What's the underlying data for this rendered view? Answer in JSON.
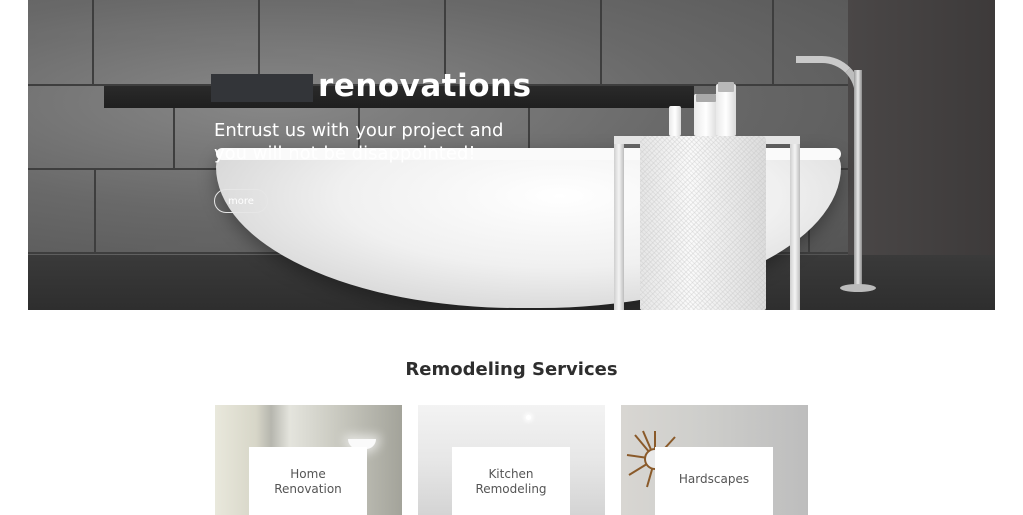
{
  "hero": {
    "title": "renovations",
    "subtitle": "Entrust us with your project and you will not be disappointed!",
    "more_button": "more"
  },
  "services": {
    "heading": "Remodeling Services",
    "cards": [
      {
        "label": "Home Renovation"
      },
      {
        "label": "Kitchen Remodeling"
      },
      {
        "label": "Hardscapes"
      }
    ]
  },
  "colors": {
    "heading_text": "#2e2e2e",
    "card_label_text": "#555555",
    "hero_text": "#ffffff"
  }
}
